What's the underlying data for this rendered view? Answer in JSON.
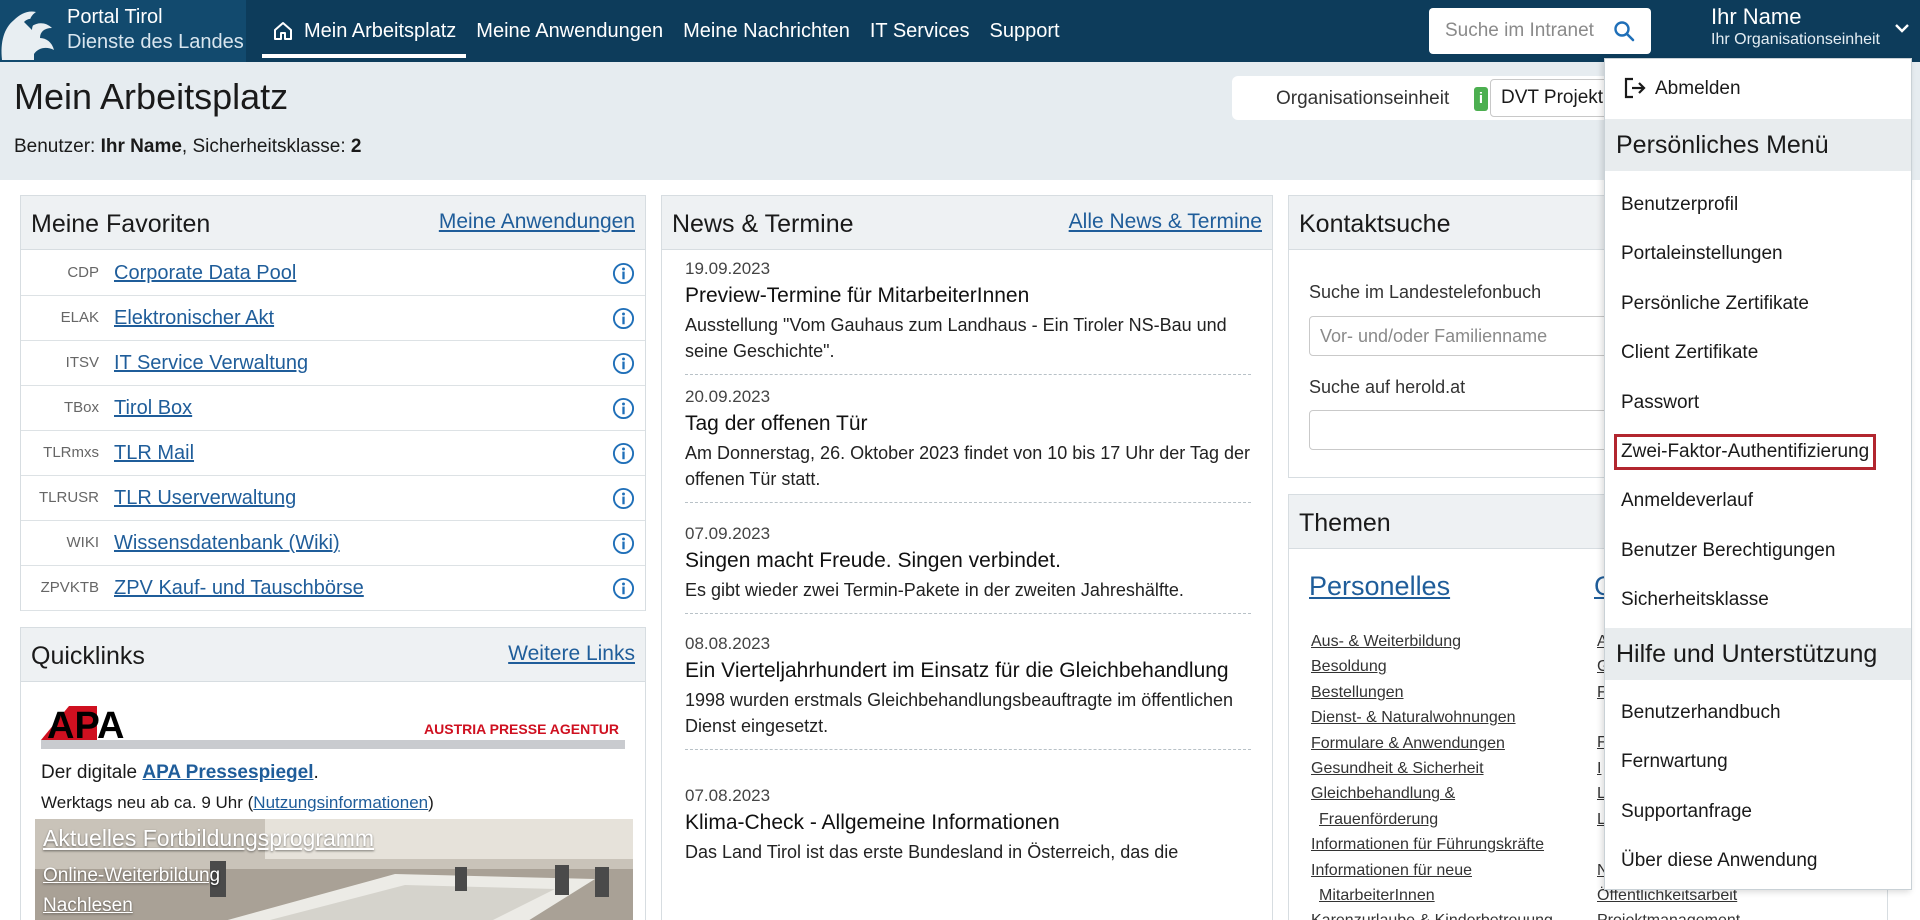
{
  "brand": {
    "line1": "Portal Tirol",
    "line2": "Dienste des Landes"
  },
  "nav": [
    {
      "label": "Mein Arbeitsplatz",
      "icon": "home-icon",
      "active": true
    },
    {
      "label": "Meine Anwendungen"
    },
    {
      "label": "Meine Nachrichten"
    },
    {
      "label": "IT Services"
    },
    {
      "label": "Support"
    }
  ],
  "search": {
    "placeholder": "Suche im Intranet",
    "icon": "search-icon"
  },
  "user": {
    "name": "Ihr Name",
    "org": "Ihr Organisationseinheit"
  },
  "page": {
    "title": "Mein Arbeitsplatz",
    "user_prefix": "Benutzer: ",
    "user_name": "Ihr Name",
    "security_prefix": ", Sicherheitsklasse: ",
    "security_level": "2"
  },
  "org": {
    "label": "Organisationseinheit",
    "info": "i",
    "selected": "DVT Projekt"
  },
  "favorites": {
    "title": "Meine Favoriten",
    "link": "Meine Anwendungen",
    "items": [
      {
        "code": "CDP",
        "name": "Corporate Data Pool"
      },
      {
        "code": "ELAK",
        "name": "Elektronischer Akt"
      },
      {
        "code": "ITSV",
        "name": "IT Service Verwaltung"
      },
      {
        "code": "TBox",
        "name": "Tirol Box"
      },
      {
        "code": "TLRmxs",
        "name": "TLR Mail"
      },
      {
        "code": "TLRUSR",
        "name": "TLR Userverwaltung"
      },
      {
        "code": "WIKI",
        "name": "Wissensdatenbank (Wiki)"
      },
      {
        "code": "ZPVKTB",
        "name": "ZPV Kauf- und Tauschbörse"
      }
    ]
  },
  "quicklinks": {
    "title": "Quicklinks",
    "link": "Weitere Links",
    "apa_logo": "APA",
    "apa_tagline": "AUSTRIA PRESSE AGENTUR",
    "apa_text1": "Der digitale ",
    "apa_link": "APA Pressespiegel",
    "apa_text1_end": ".",
    "apa_text2": "Werktags neu ab ca. 9 Uhr (",
    "apa_text2_link": "Nutzungsinformationen",
    "apa_text2_end": ")",
    "fb_title": "Aktuelles Fortbildungsprogramm",
    "fb_link1": "Online-Weiterbildung",
    "fb_link2": "Nachlesen"
  },
  "news": {
    "title": "News & Termine",
    "link": "Alle News & Termine",
    "items": [
      {
        "date": "19.09.2023",
        "title": "Preview-Termine für MitarbeiterInnen",
        "text": "Ausstellung \"Vom Gauhaus zum Landhaus - Ein Tiroler NS-Bau und seine Geschichte\"."
      },
      {
        "date": "20.09.2023",
        "title": "Tag der offenen Tür",
        "text": "Am Donnerstag, 26. Oktober 2023 findet von 10 bis 17 Uhr der Tag der offenen Tür statt."
      },
      {
        "date": "07.09.2023",
        "title": "Singen macht Freude. Singen verbindet.",
        "text": "Es gibt wieder zwei Termin-Pakete in der zweiten Jahreshälfte."
      },
      {
        "date": "08.08.2023",
        "title": "Ein Vierteljahrhundert im Einsatz für die Gleichbehandlung",
        "text": "1998 wurden erstmals Gleichbehandlungsbeauftragte im öffentlichen Dienst eingesetzt."
      },
      {
        "date": "07.08.2023",
        "title": "Klima-Check - Allgemeine Informationen",
        "text": "Das Land Tirol ist das erste Bundesland in Österreich, das die"
      }
    ]
  },
  "contact": {
    "title": "Kontaktsuche",
    "phonebook_label": "Suche im Landestelefonbuch",
    "phonebook_placeholder": "Vor- und/oder Familienname",
    "herold_label": "Suche auf herold.at"
  },
  "themes": {
    "title": "Themen",
    "col1_heading": "Personelles",
    "col2_heading_partial": "G",
    "col1": [
      "Aus- & Weiterbildung",
      "Besoldung",
      "Bestellungen",
      "Dienst- & Naturalwohnungen",
      "Formulare & Anwendungen",
      "Gesundheit & Sicherheit",
      "Gleichbehandlung &",
      "Frauenförderung",
      "Informationen für Führungskräfte",
      "Informationen für neue",
      "MitarbeiterInnen",
      "Karenzurlaube & Kinderbetreuung"
    ],
    "col2_partial": [
      "A",
      "G",
      "F",
      "F",
      "I",
      "L",
      "L",
      "N",
      "Öffentlichkeitsarbeit",
      "Projektmanagement"
    ]
  },
  "dropdown": {
    "logout": "Abmelden",
    "section1": "Persönliches Menü",
    "items1": [
      "Benutzerprofil",
      "Portaleinstellungen",
      "Persönliche Zertifikate",
      "Client Zertifikate",
      "Passwort",
      "Zwei-Faktor-Authentifizierung",
      "Anmeldeverlauf",
      "Benutzer Berechtigungen",
      "Sicherheitsklasse"
    ],
    "highlighted": "Zwei-Faktor-Authentifizierung",
    "section2": "Hilfe und Unterstützung",
    "items2": [
      "Benutzerhandbuch",
      "Fernwartung",
      "Supportanfrage",
      "Über diese Anwendung"
    ]
  },
  "colors": {
    "topbar": "#0d3c5b",
    "link": "#1f5d9a",
    "highlight": "#b2262f",
    "info_badge": "#4caf50"
  }
}
